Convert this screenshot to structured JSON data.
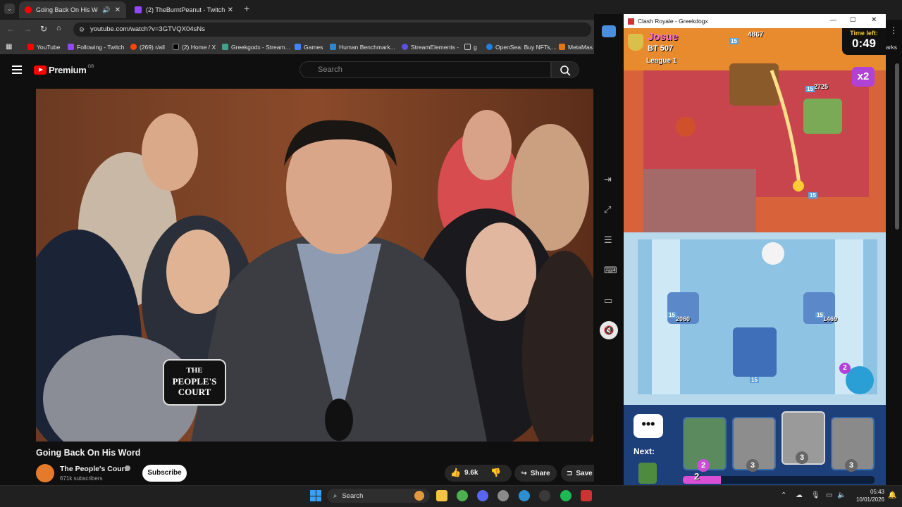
{
  "browser": {
    "tabs": [
      {
        "label": "Going Back On His Word -"
      },
      {
        "label": "(2) TheBurntPeanut - Twitch"
      }
    ],
    "address": "youtube.com/watch?v=3GTVQX04sNs",
    "bookmarks": [
      "YouTube",
      "Following - Twitch",
      "(269) r/all",
      "(2) Home / X",
      "Greekgodx - Stream...",
      "Games",
      "Human Benchmark...",
      "StreamElements -",
      "g",
      "OpenSea: Buy NFTs,...",
      "MetaMas"
    ],
    "bookmark_overflow_label": "arks"
  },
  "youtube": {
    "logo_label": "Premium",
    "region": "GB",
    "search_placeholder": "Search",
    "video_title": "Going Back On His Word",
    "overlay_logo": {
      "line1": "THE",
      "line2": "PEOPLE'S",
      "line3": "COURT"
    },
    "channel": {
      "name": "The People's Court",
      "subs": "671k subscribers",
      "subscribe_label": "Subscribe"
    },
    "actions": {
      "likes": "9.6k",
      "share": "Share",
      "save": "Save"
    }
  },
  "game": {
    "window_title": "Clash Royale - Greekdogx",
    "player": {
      "name": "Josue",
      "bt": "BT 507",
      "league": "League 1"
    },
    "timer_label": "Time left:",
    "timer": "0:49",
    "multiplier": "x2",
    "king_hp_enemy": "4867",
    "tower_hp_enemy_right": "2725",
    "tower_hp_left": "2060",
    "tower_hp_right": "1469",
    "levels": [
      "15",
      "15",
      "15",
      "15",
      "15",
      "15"
    ],
    "next_label": "Next:",
    "emote_badge": "2",
    "cards": [
      {
        "name": "goblin-hut-card",
        "cost": "2"
      },
      {
        "name": "skeleton-army-card",
        "cost": "3"
      },
      {
        "name": "graveyard-card",
        "cost": "3"
      },
      {
        "name": "barbarians-card",
        "cost": "3"
      }
    ],
    "elixir": "2",
    "elixir_fill": 0.2
  },
  "taskbar": {
    "search_label": "Search",
    "time": "05:43",
    "date": "10/01/2026"
  }
}
